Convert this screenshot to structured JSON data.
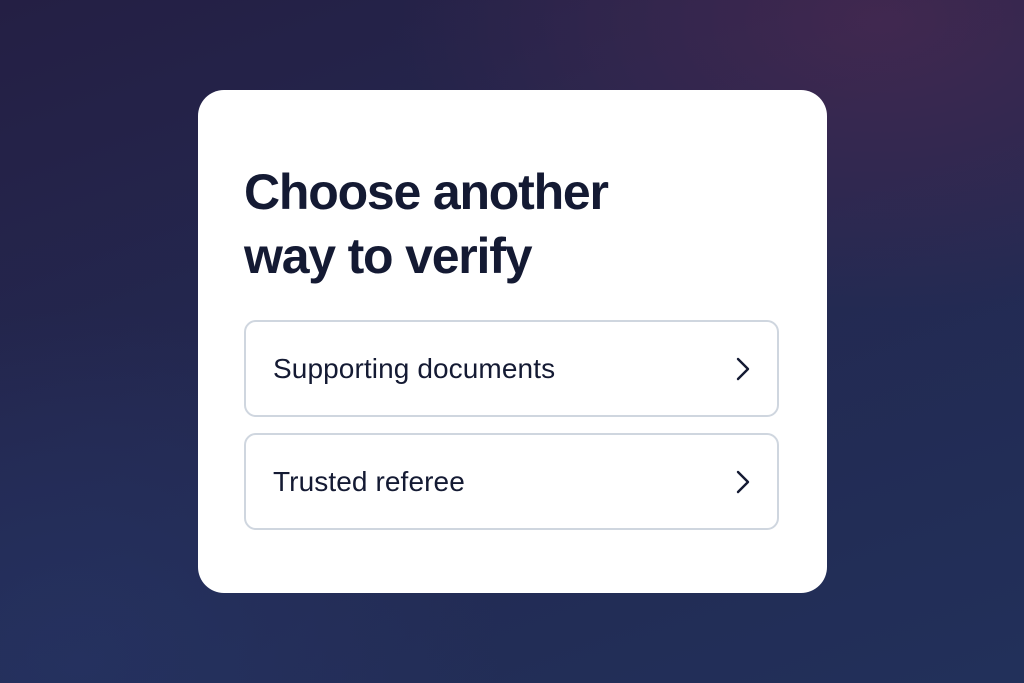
{
  "dialog": {
    "title_line1": "Choose another",
    "title_line2": "way to verify",
    "options": [
      {
        "label": "Supporting documents",
        "icon": "chevron-right-icon"
      },
      {
        "label": "Trusted referee",
        "icon": "chevron-right-icon"
      }
    ]
  },
  "colors": {
    "text": "#141a33",
    "border": "#cfd6df",
    "card_background": "#ffffff",
    "page_background": "#232850"
  }
}
